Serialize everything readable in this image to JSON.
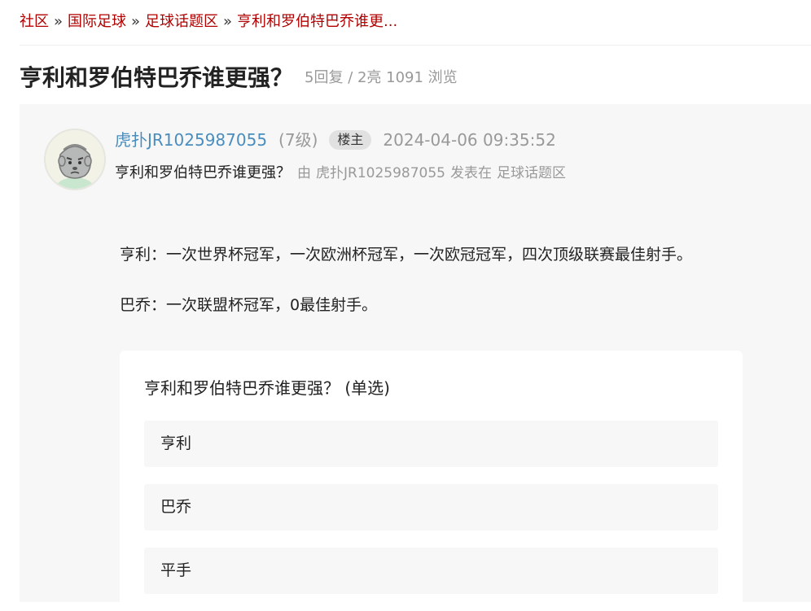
{
  "breadcrumb": {
    "items": [
      "社区",
      "国际足球",
      "足球话题区",
      "亨利和罗伯特巴乔谁更..."
    ],
    "separator": "»"
  },
  "thread": {
    "title": "亨利和罗伯特巴乔谁更强？",
    "stats": "5回复 / 2亮 1091 浏览"
  },
  "post": {
    "author": "虎扑JR1025987055",
    "level": "(7级)",
    "owner_badge": "楼主",
    "time": "2024-04-06 09:35:52",
    "subtitle": "亨利和罗伯特巴乔谁更强？",
    "meta_prefix": "由",
    "meta_author": "虎扑JR1025987055",
    "meta_posted": "发表在",
    "meta_board": "足球话题区",
    "paragraphs": [
      "亨利：一次世界杯冠军，一次欧洲杯冠军，一次欧冠冠军，四次顶级联赛最佳射手。",
      "巴乔：一次联盟杯冠军，0最佳射手。"
    ]
  },
  "poll": {
    "question": "亨利和罗伯特巴乔谁更强？ (单选)",
    "options": [
      "亨利",
      "巴乔",
      "平手"
    ]
  },
  "colors": {
    "link_red": "#b20000",
    "author_blue": "#4b8dbd",
    "muted": "#999999",
    "panel_bg": "#f7f7f7"
  }
}
